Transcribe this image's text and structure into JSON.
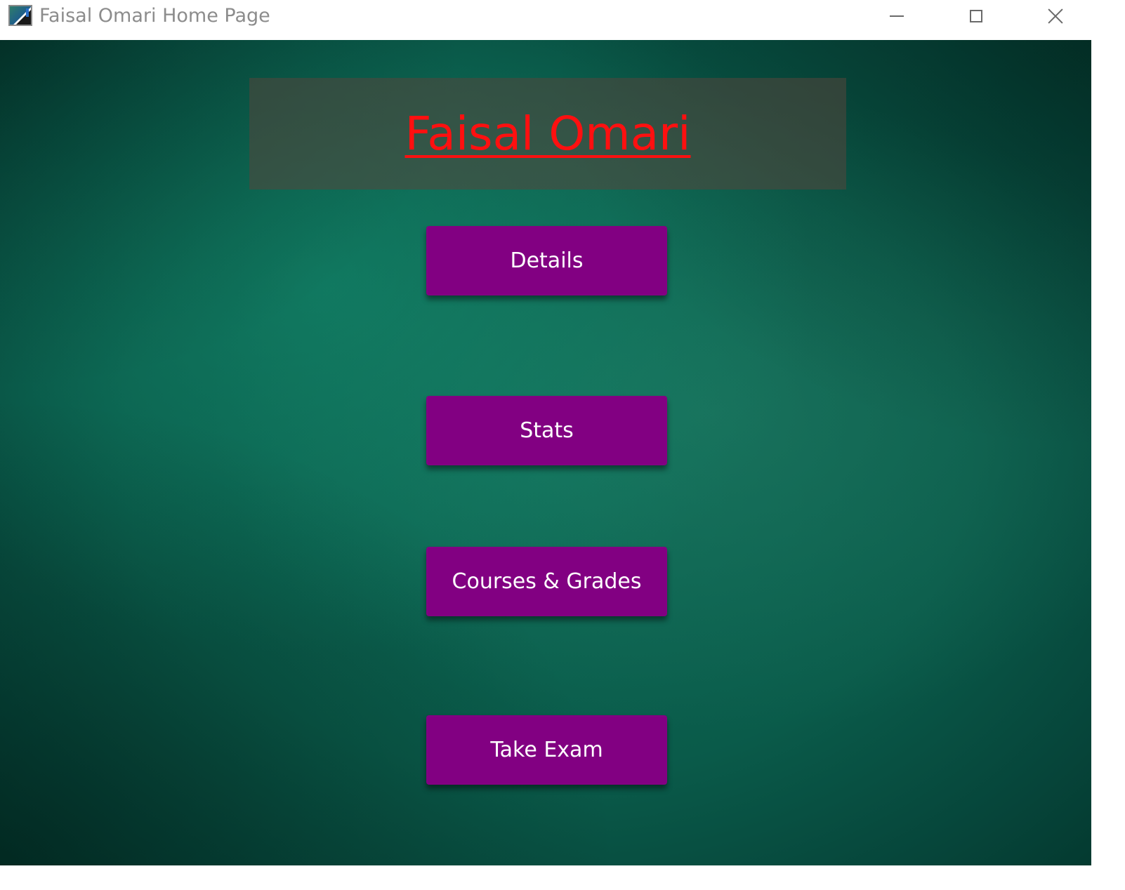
{
  "window": {
    "title": "Faisal Omari Home Page",
    "controls": {
      "minimize": "minimize",
      "maximize": "maximize",
      "close": "close"
    }
  },
  "header": {
    "name": "Faisal Omari",
    "name_color": "#ff1010"
  },
  "menu": {
    "buttons": [
      {
        "label": "Details"
      },
      {
        "label": "Stats"
      },
      {
        "label": "Courses & Grades"
      },
      {
        "label": "Take Exam"
      }
    ],
    "button_color": "#820082",
    "button_text_color": "#ffffff"
  },
  "theme": {
    "background": "#0a5b4a",
    "header_panel": "#55463c"
  },
  "icons": {
    "app": "app-window-icon",
    "minimize": "minimize-icon",
    "maximize": "maximize-icon",
    "close": "close-icon"
  }
}
